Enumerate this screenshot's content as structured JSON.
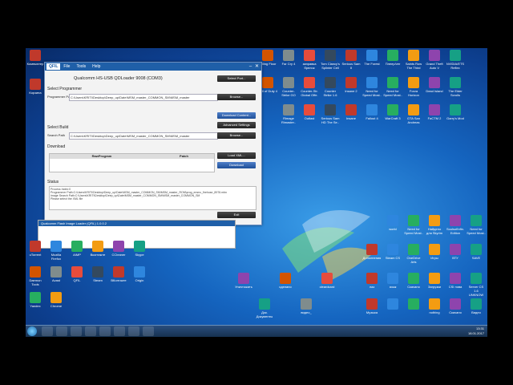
{
  "qfil": {
    "logo": "QFIL",
    "menu": [
      "File",
      "Tools",
      "Help"
    ],
    "port_title": "Qualcomm HS-USB QDLoader 9008 (COM3)",
    "select_port_label": "Select Port...",
    "select_programmer_label": "Select Programmer",
    "programmer_path_label": "Programmer Path",
    "programmer_path_value": "C:\\Users\\KRITI\\Desktop\\Deep_up\\Date\\MSM_master_COMMON_SM\\MSM_master",
    "browse_label": "Browse...",
    "download_content_label": "Download Content...",
    "select_build_label": "Select Build",
    "advanced_settings_label": "Advanced Settings",
    "search_path_label": "Search Path",
    "search_path_value": "C:\\Users\\KRITI\\Desktop\\Deep_up\\Date\\MSM_master_COMMON_SM\\MSM_master",
    "download_label": "Download",
    "columns": [
      "RawProgram",
      "Patch"
    ],
    "load_xml_label": "Load XML...",
    "download_button_label": "Download",
    "status_label": "Status",
    "status_lines": [
      "Process Index:0",
      "Programmer Path:C:\\Users\\KRITI\\Desktop\\Deep_up\\Date\\MSM_master_COMMON_SM\\MSM_master_ROM\\prog_emmc_firehose_8976.mbn",
      "Image Search Path:C:\\Users\\KRITI\\Desktop\\Deep_up\\Date\\MSM_master_COMMON_SM\\MSM_master_COMMON_SM",
      "Please select the XML file"
    ],
    "exit_label": "Exit"
  },
  "notice": {
    "title": "Qualcomm Flash Image Loader (QFIL)   1.0.0.2"
  },
  "desktop_top": [
    "Компьютер",
    "",
    "",
    "",
    "",
    "",
    "Killing Floor",
    "Far Cry 4",
    "заправка брелок",
    "Tom Clancy's Splinter Cell",
    "Serious Sam II",
    "The Forest",
    "Плеер/ver",
    "Saints Row The Third",
    "Grand Theft Auto V",
    "NVIDIA/ETS Reflex"
  ],
  "desktop_row2": [
    "Корзина",
    "",
    "",
    "",
    "",
    "",
    "Call of Duty 4",
    "Counter-Strike GO",
    "Counter-Str. Global Offe.",
    "Counter Strike 1.6",
    "Insane 2",
    "Need for Speed Most..",
    "Need for Speed Most..",
    "Forza Horizon",
    "Dead Island",
    "The Elder Scrolls"
  ],
  "desktop_row3": [
    "",
    "",
    "",
    "",
    "",
    "",
    "",
    "Rimage Rimaster..",
    "Outlast",
    "Serious Sam HD The Se..",
    "Insane",
    "Fallout 4",
    "WarCraft 3",
    "GTA San Andreas",
    "FaCTM 2",
    "Garry's Mod"
  ],
  "desktop_left": [
    "uTorrent",
    "Mozilla Firefox",
    "AIMP",
    "Вконтакте",
    "CCleaner",
    "Skype",
    "Daemon Tools",
    "Avast",
    "QFIL",
    "Steam",
    "ВКонтакте",
    "Origin",
    "Yandex",
    "Chrome"
  ],
  "desktop_right_top": [
    "",
    "world",
    "Need for Speed Most..",
    "Найдено для Skyrim",
    "SoulsofInfin. Edition",
    "Need for Speed Most.."
  ],
  "desktop_right_mid": [
    "Дополнения",
    "Steam CS",
    "OneDrive Arts",
    "Игры",
    "ВТУ",
    "SAVE"
  ],
  "desktop_right_low": [
    "лаз",
    "язык",
    "Скачано",
    "Загрузки",
    "CSI нова",
    "Server CS 1.6 UNKNOW"
  ],
  "desktop_right_bottom": [
    "Музыка",
    "",
    "",
    "nothing",
    "Скачано",
    "Видео"
  ],
  "desktop_bottom_mid": [
    "",
    "",
    "",
    "",
    "Уничтожить",
    "Док. Документы",
    "сделано",
    "видео_",
    "cleardcard"
  ],
  "taskbar": {
    "time": "13:31",
    "date": "18.01.2017"
  }
}
